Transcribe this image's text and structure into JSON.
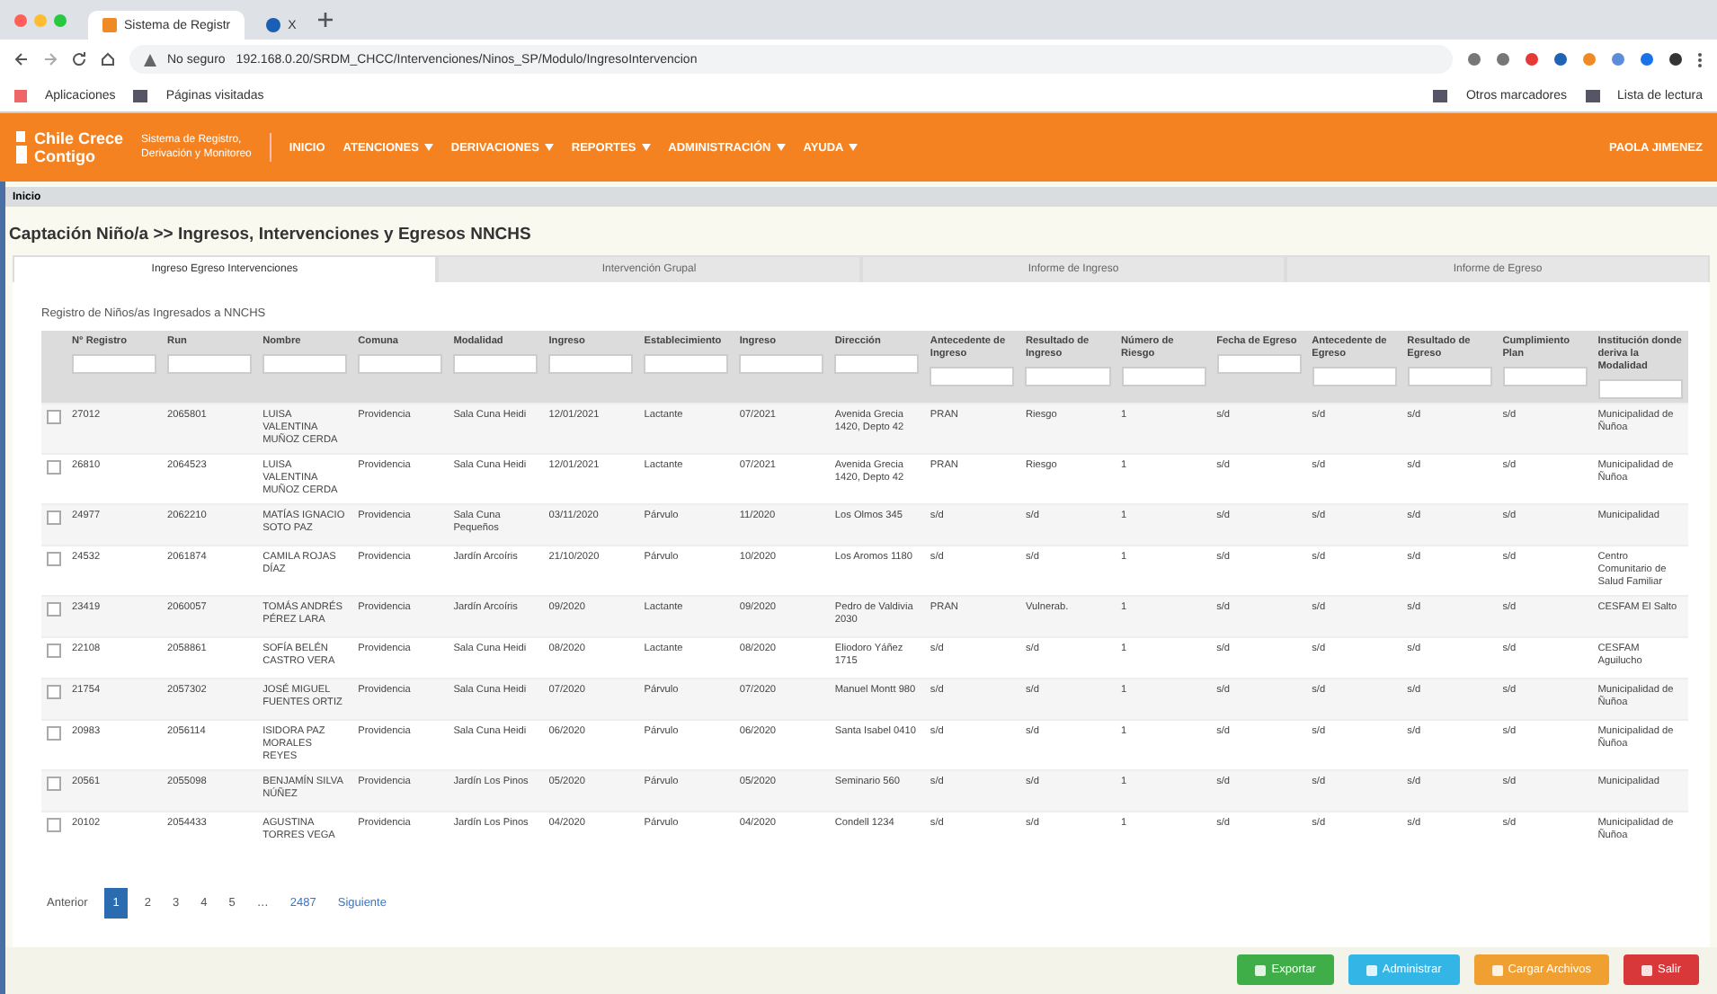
{
  "browser": {
    "tabs": [
      {
        "title": "Sistema de Registr",
        "selected": true
      },
      {
        "title": "X",
        "selected": false
      }
    ],
    "url_security": "No seguro",
    "url": "192.168.0.20/SRDM_CHCC/Intervenciones/Ninos_SP/Modulo/IngresoIntervencion",
    "bookmarks": [
      "Aplicaciones",
      "Páginas visitadas"
    ],
    "bookmarks_right": [
      "Otros marcadores",
      "Lista de lectura"
    ]
  },
  "navbar": {
    "logo_line1": "Chile Crece",
    "logo_line2": "Contigo",
    "subtitle_line1": "Sistema de Registro,",
    "subtitle_line2": "Derivación y Monitoreo",
    "menu": [
      "INICIO",
      "ATENCIONES",
      "DERIVACIONES",
      "REPORTES",
      "ADMINISTRACIÓN",
      "AYUDA"
    ],
    "user": "PAOLA JIMENEZ"
  },
  "breadcrumb": "Inicio",
  "page_title": "Captación Niño/a >> Ingresos, Intervenciones y Egresos NNCHS",
  "tabs": [
    {
      "label": "Ingreso Egreso Intervenciones",
      "selected": true
    },
    {
      "label": "Intervención Grupal",
      "selected": false
    },
    {
      "label": "Informe de Ingreso",
      "selected": false
    },
    {
      "label": "Informe de Egreso",
      "selected": false
    }
  ],
  "panel_title": "Registro de Niños/as Ingresados a NNCHS",
  "table": {
    "columns": [
      "N° Registro",
      "Run",
      "Nombre",
      "Comuna",
      "Modalidad",
      "Ingreso",
      "Establecimiento",
      "Ingreso",
      "Dirección",
      "Antecedente de Ingreso",
      "Resultado de Ingreso",
      "Número de Riesgo",
      "Fecha de Egreso",
      "Antecedente de Egreso",
      "Resultado de Egreso",
      "Cumplimiento Plan",
      "Institución donde deriva la Modalidad"
    ],
    "rows": [
      {
        "checked": false,
        "cells": [
          "27012",
          "2065801",
          "LUISA VALENTINA MUÑOZ CERDA",
          "Providencia",
          "Sala Cuna Heidi",
          "12/01/2021",
          "Lactante",
          "07/2021",
          "Avenida Grecia 1420, Depto 42",
          "PRAN",
          "Riesgo",
          "1",
          "s/d",
          "s/d",
          "s/d",
          "s/d",
          "Municipalidad de Ñuñoa"
        ]
      },
      {
        "checked": false,
        "cells": [
          "26810",
          "2064523",
          "LUISA VALENTINA MUÑOZ CERDA",
          "Providencia",
          "Sala Cuna Heidi",
          "12/01/2021",
          "Lactante",
          "07/2021",
          "Avenida Grecia 1420, Depto 42",
          "PRAN",
          "Riesgo",
          "1",
          "s/d",
          "s/d",
          "s/d",
          "s/d",
          "Municipalidad de Ñuñoa"
        ]
      },
      {
        "checked": false,
        "cells": [
          "24977",
          "2062210",
          "MATÍAS IGNACIO SOTO PAZ",
          "Providencia",
          "Sala Cuna Pequeños",
          "03/11/2020",
          "Párvulo",
          "11/2020",
          "Los Olmos 345",
          "s/d",
          "s/d",
          "1",
          "s/d",
          "s/d",
          "s/d",
          "s/d",
          "Municipalidad"
        ]
      },
      {
        "checked": false,
        "cells": [
          "24532",
          "2061874",
          "CAMILA ROJAS DÍAZ",
          "Providencia",
          "Jardín Arcoíris",
          "21/10/2020",
          "Párvulo",
          "10/2020",
          "Los Aromos 1180",
          "s/d",
          "s/d",
          "1",
          "s/d",
          "s/d",
          "s/d",
          "s/d",
          "Centro Comunitario de Salud Familiar"
        ]
      },
      {
        "checked": false,
        "cells": [
          "23419",
          "2060057",
          "TOMÁS ANDRÉS PÉREZ LARA",
          "Providencia",
          "Jardín Arcoíris",
          "09/2020",
          "Lactante",
          "09/2020",
          "Pedro de Valdivia 2030",
          "PRAN",
          "Vulnerab.",
          "1",
          "s/d",
          "s/d",
          "s/d",
          "s/d",
          "CESFAM El Salto"
        ]
      },
      {
        "checked": false,
        "cells": [
          "22108",
          "2058861",
          "SOFÍA BELÉN CASTRO VERA",
          "Providencia",
          "Sala Cuna Heidi",
          "08/2020",
          "Lactante",
          "08/2020",
          "Eliodoro Yáñez 1715",
          "s/d",
          "s/d",
          "1",
          "s/d",
          "s/d",
          "s/d",
          "s/d",
          "CESFAM Aguilucho"
        ]
      },
      {
        "checked": false,
        "cells": [
          "21754",
          "2057302",
          "JOSÉ MIGUEL FUENTES ORTIZ",
          "Providencia",
          "Sala Cuna Heidi",
          "07/2020",
          "Párvulo",
          "07/2020",
          "Manuel Montt 980",
          "s/d",
          "s/d",
          "1",
          "s/d",
          "s/d",
          "s/d",
          "s/d",
          "Municipalidad de Ñuñoa"
        ]
      },
      {
        "checked": false,
        "cells": [
          "20983",
          "2056114",
          "ISIDORA PAZ MORALES REYES",
          "Providencia",
          "Sala Cuna Heidi",
          "06/2020",
          "Párvulo",
          "06/2020",
          "Santa Isabel 0410",
          "s/d",
          "s/d",
          "1",
          "s/d",
          "s/d",
          "s/d",
          "s/d",
          "Municipalidad de Ñuñoa"
        ]
      },
      {
        "checked": false,
        "cells": [
          "20561",
          "2055098",
          "BENJAMÍN SILVA NÚÑEZ",
          "Providencia",
          "Jardín Los Pinos",
          "05/2020",
          "Párvulo",
          "05/2020",
          "Seminario 560",
          "s/d",
          "s/d",
          "1",
          "s/d",
          "s/d",
          "s/d",
          "s/d",
          "Municipalidad"
        ]
      },
      {
        "checked": false,
        "cells": [
          "20102",
          "2054433",
          "AGUSTINA TORRES VEGA",
          "Providencia",
          "Jardín Los Pinos",
          "04/2020",
          "Párvulo",
          "04/2020",
          "Condell 1234",
          "s/d",
          "s/d",
          "1",
          "s/d",
          "s/d",
          "s/d",
          "s/d",
          "Municipalidad de Ñuñoa"
        ]
      }
    ]
  },
  "pagination": {
    "previous": "Anterior",
    "pages": [
      {
        "label": "1",
        "selected": true
      },
      {
        "label": "2",
        "selected": false
      },
      {
        "label": "3",
        "selected": false
      },
      {
        "label": "4",
        "selected": false
      },
      {
        "label": "5",
        "selected": false
      }
    ],
    "ellipsis": "…",
    "last": "2487",
    "next": "Siguiente"
  },
  "actions": [
    {
      "label": "Exportar",
      "kind": "success"
    },
    {
      "label": "Administrar",
      "kind": "info"
    },
    {
      "label": "Cargar Archivos",
      "kind": "warning"
    },
    {
      "label": "Salir",
      "kind": "danger"
    }
  ]
}
